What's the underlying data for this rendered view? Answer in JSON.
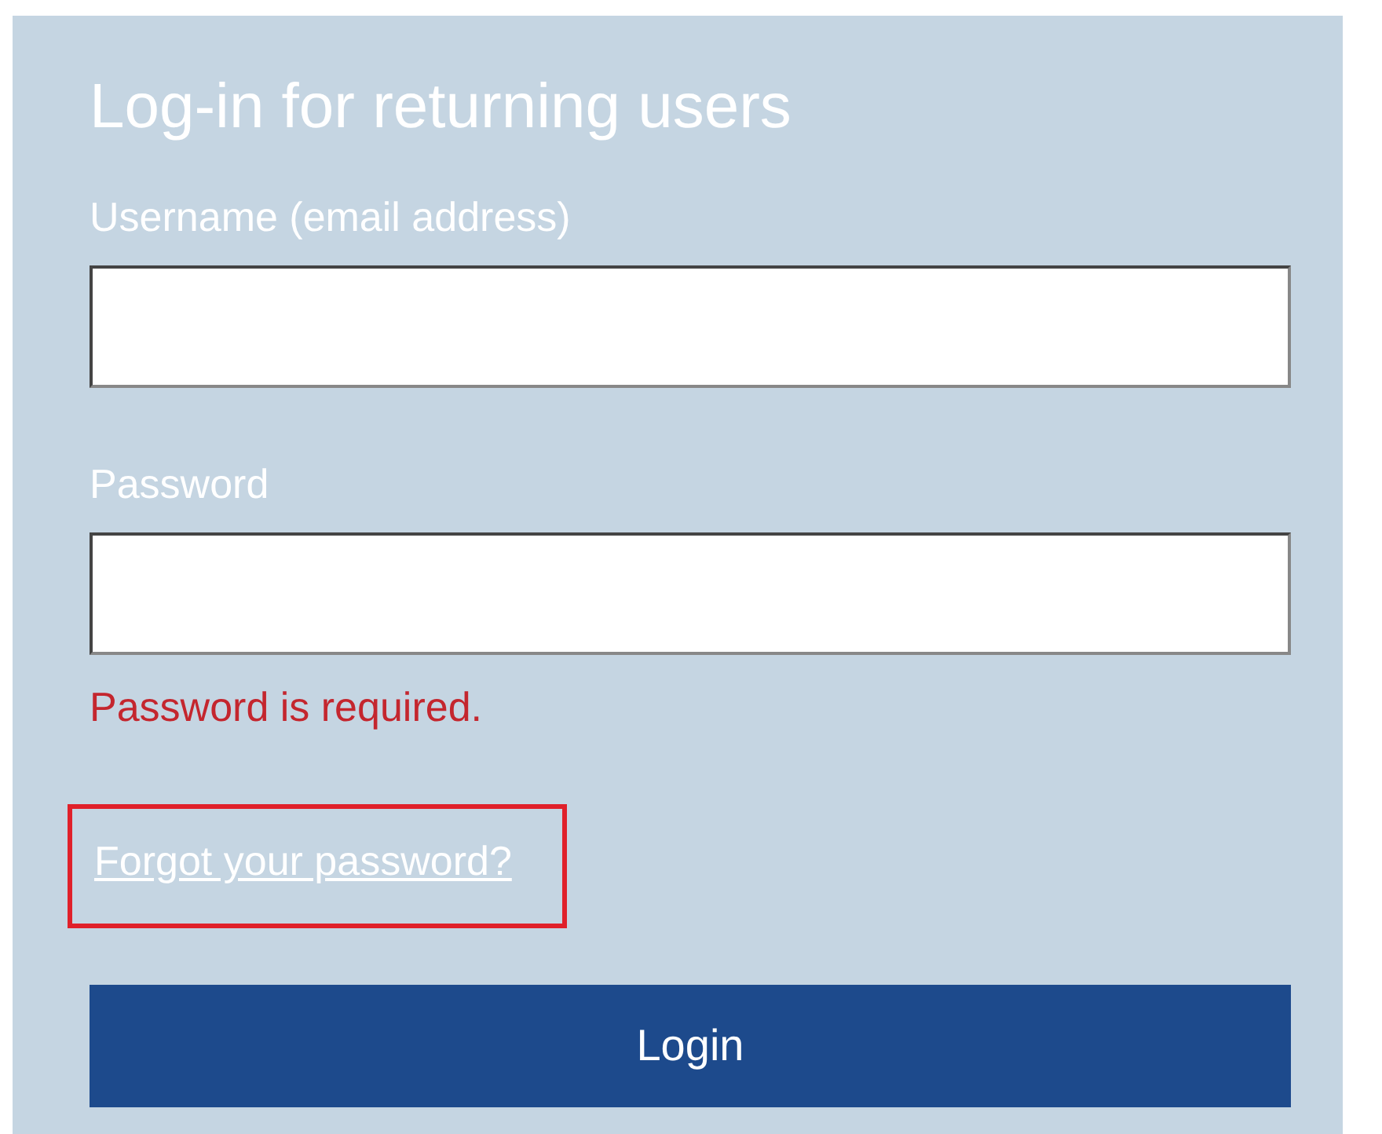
{
  "title": "Log-in for returning users",
  "fields": [
    {
      "label": "Username (email address)"
    },
    {
      "label": "Password",
      "error": "Password is required."
    }
  ],
  "forgot_link": {
    "text": "Forgot your password?",
    "highlighted": true
  },
  "login_button": {
    "label": "Login"
  }
}
